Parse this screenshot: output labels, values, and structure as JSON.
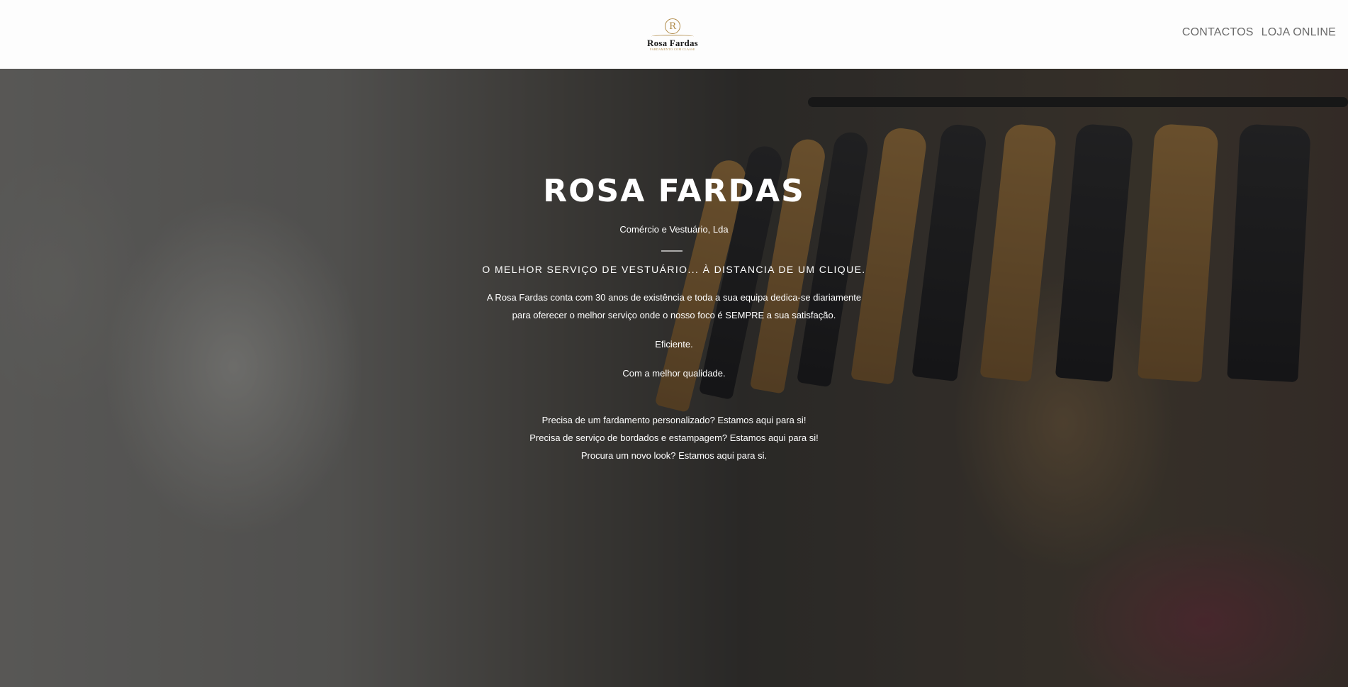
{
  "header": {
    "logo": {
      "monogram": "R",
      "name": "Rosa Fardas",
      "tagline": "FARDAMENTO COM CLASSE"
    },
    "nav": [
      {
        "label": "CONTACTOS"
      },
      {
        "label": "LOJA ONLINE"
      }
    ]
  },
  "hero": {
    "title": "ROSA FARDAS",
    "subtitle": "Comércio e Vestuário, Lda",
    "tagline": "O MELHOR SERVIÇO DE VESTUÁRIO... À DISTANCIA DE UM CLIQUE.",
    "intro_line1": "A Rosa Fardas conta com 30 anos de existência e toda a sua equipa dedica-se diariamente",
    "intro_line2": "para oferecer o melhor serviço onde o nosso foco é SEMPRE a sua satisfação.",
    "point1": "Eficiente.",
    "point2": "Com a melhor qualidade.",
    "cta_line1": "Precisa de um fardamento personalizado? Estamos aqui para si!",
    "cta_line2": "Precisa de serviço de bordados e estampagem? Estamos aqui para si!",
    "cta_line3": "Procura um novo look? Estamos aqui para si."
  },
  "colors": {
    "brand_gold": "#b08a47",
    "nav_text": "#6b6b6b",
    "hero_text": "#ffffff"
  }
}
